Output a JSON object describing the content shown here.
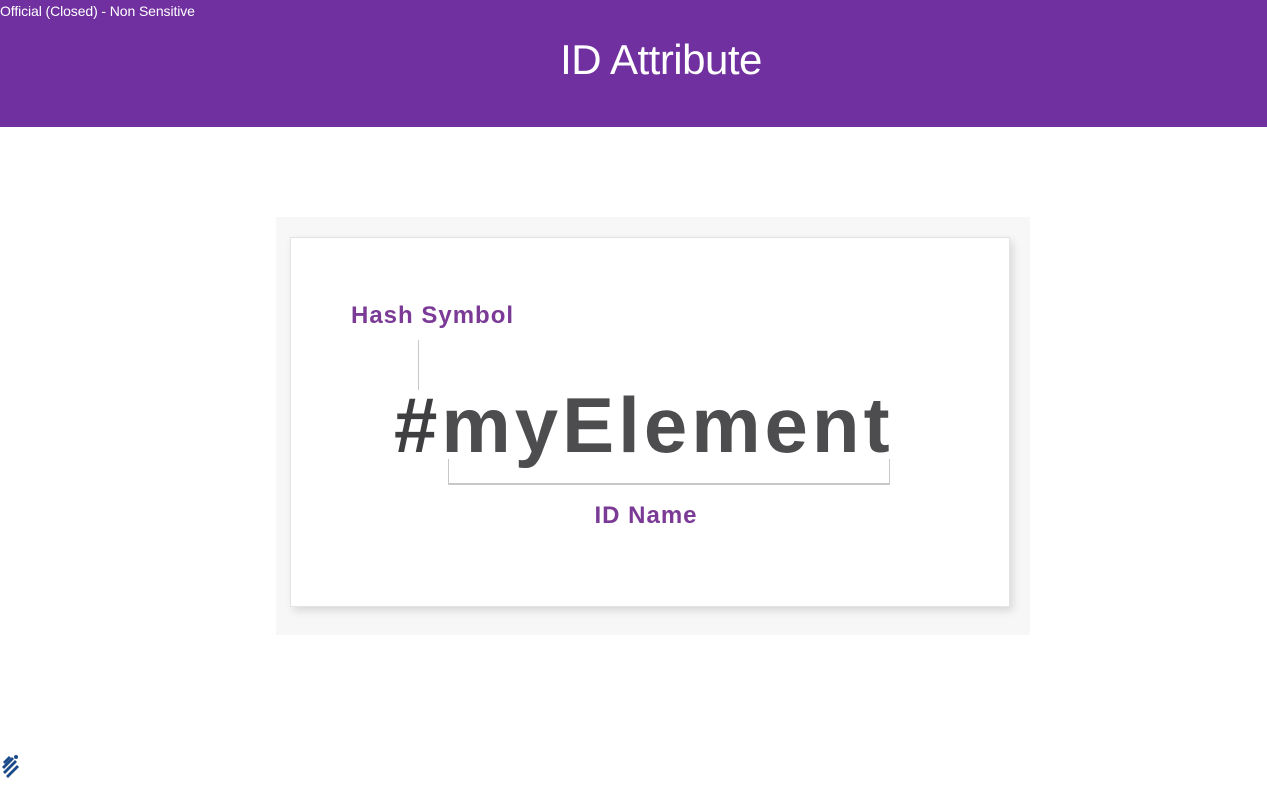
{
  "header": {
    "classification": "Official (Closed) - Non Sensitive",
    "title": "ID Attribute",
    "background_color": "#7030a0"
  },
  "diagram": {
    "hash_label": "Hash Symbol",
    "selector_hash": "#",
    "selector_name": "myElement",
    "id_name_label": "ID Name",
    "label_color": "#7a3a96",
    "selector_color": "#4d4d4f"
  },
  "footer": {
    "logo_icon": "institution-logo-icon"
  }
}
